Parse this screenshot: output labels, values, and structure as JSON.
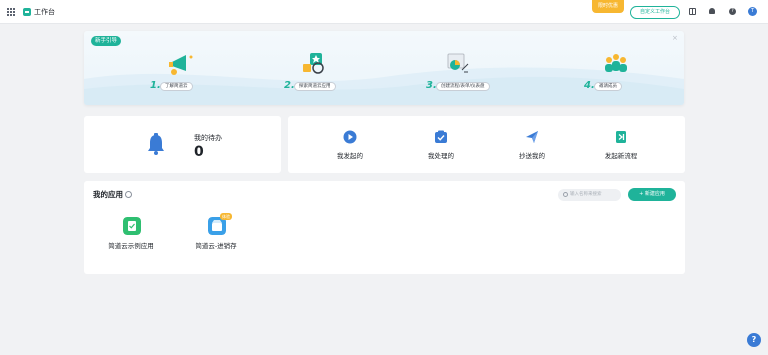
{
  "header": {
    "title": "工作台",
    "promo_label": "限时优惠",
    "customize_label": "自定义工作台",
    "avatar_initial": "T",
    "help_glyph": "?",
    "icons": [
      "apps-grid-icon",
      "book-icon",
      "bell-icon",
      "help-icon"
    ]
  },
  "guide": {
    "tag": "新手引导",
    "close_glyph": "×",
    "steps": [
      {
        "num": "1.",
        "label": "了解简道云"
      },
      {
        "num": "2.",
        "label": "探索简道云应用"
      },
      {
        "num": "3.",
        "label": "创建流程/表单/仪表盘"
      },
      {
        "num": "4.",
        "label": "邀请成员"
      }
    ]
  },
  "todo": {
    "label": "我的待办",
    "count": "0"
  },
  "flows": [
    {
      "label": "我发起的",
      "icon": "play-icon"
    },
    {
      "label": "我处理的",
      "icon": "check-box-icon"
    },
    {
      "label": "抄送我的",
      "icon": "send-icon"
    },
    {
      "label": "发起新流程",
      "icon": "new-flow-icon"
    }
  ],
  "apps": {
    "title": "我的应用",
    "search_placeholder": "输入名称来搜索",
    "new_app_label": "+ 新建应用",
    "items": [
      {
        "name": "简道云示例应用",
        "badge": ""
      },
      {
        "name": "简道云-进销存",
        "badge": "体验"
      }
    ]
  },
  "help_fab_glyph": "?",
  "colors": {
    "accent": "#1fb39a",
    "badge": "#f7b731",
    "blue": "#3a7bd5"
  }
}
